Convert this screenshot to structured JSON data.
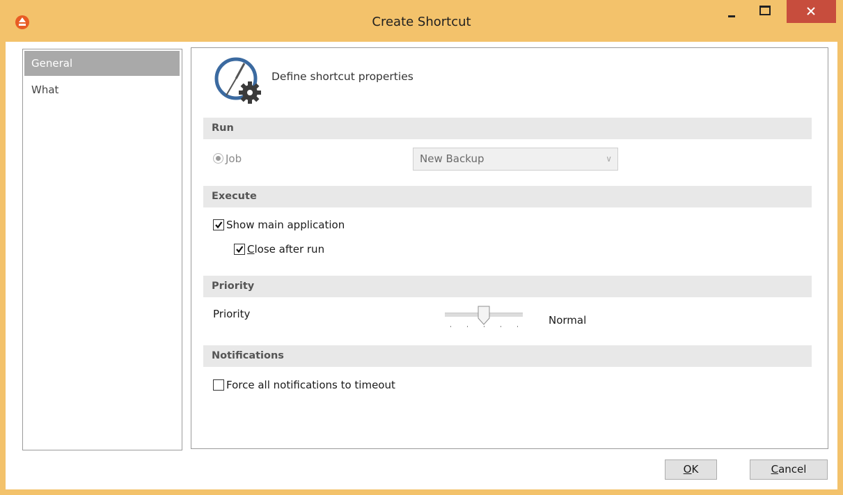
{
  "window": {
    "title": "Create Shortcut",
    "accent_color": "#f3c26b",
    "close_color": "#c74d3d",
    "app_icon": "eject-icon"
  },
  "sidebar": {
    "items": [
      {
        "label": "General",
        "selected": true
      },
      {
        "label": "What",
        "selected": false
      }
    ]
  },
  "header": {
    "icon": "clock-gear-icon",
    "text": "Define shortcut properties"
  },
  "sections": {
    "run": "Run",
    "execute": "Execute",
    "priority": "Priority",
    "notifications": "Notifications"
  },
  "run": {
    "job_label": "Job",
    "job_selected": true,
    "job_value": "New Backup",
    "enabled": false
  },
  "execute": {
    "show_main_app": {
      "label": "Show main application",
      "checked": true
    },
    "close_after_run": {
      "label_hotkey": "C",
      "label_rest": "lose after run",
      "checked": true
    }
  },
  "priority": {
    "label": "Priority",
    "value": "Normal",
    "level": 2,
    "levels": 5
  },
  "notifications": {
    "force_timeout": {
      "label": "Force all notifications to timeout",
      "checked": false
    }
  },
  "buttons": {
    "ok_hotkey": "O",
    "ok_rest": "K",
    "cancel_hotkey": "C",
    "cancel_rest": "ancel"
  }
}
